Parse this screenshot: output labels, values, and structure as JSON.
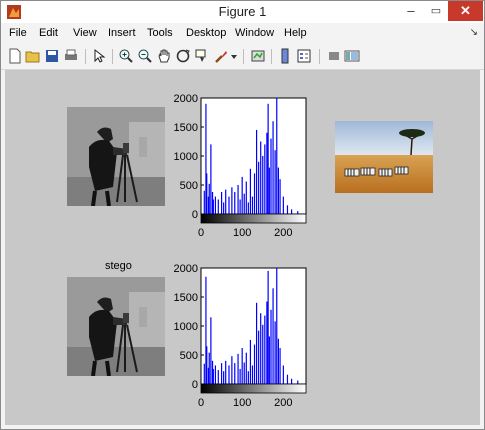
{
  "window": {
    "title": "Figure 1",
    "minimize_glyph": "–",
    "maximize_glyph": "▭",
    "close_glyph": "✕"
  },
  "menu": {
    "items": [
      "File",
      "Edit",
      "View",
      "Insert",
      "Tools",
      "Desktop",
      "Window",
      "Help"
    ],
    "dock_arrow": "↘"
  },
  "toolbar": {
    "icons": [
      "new-figure-icon",
      "open-file-icon",
      "save-figure-icon",
      "print-figure-icon",
      "edit-plot-icon",
      "zoom-in-icon",
      "zoom-out-icon",
      "pan-icon",
      "rotate-3d-icon",
      "data-cursor-icon",
      "brush-icon",
      "brush-dropdown-icon",
      "link-plot-icon",
      "insert-colorbar-icon",
      "insert-legend-icon",
      "hide-plot-tools-icon",
      "show-plot-tools-icon"
    ]
  },
  "colors": {
    "figure_bg": "#c8c8c8",
    "histogram_bar": "#0000ff",
    "close_button": "#c7392b"
  },
  "figure": {
    "stego_title": "stego"
  },
  "chart_data": [
    {
      "type": "bar",
      "xlim": [
        0,
        255
      ],
      "ylim": [
        0,
        2000
      ],
      "yticks": [
        0,
        500,
        1000,
        1500,
        2000
      ],
      "xticks": [
        0,
        100,
        200
      ],
      "colorbar": "grayscale",
      "bins": [
        [
          8,
          400
        ],
        [
          12,
          1900
        ],
        [
          14,
          700
        ],
        [
          18,
          300
        ],
        [
          20,
          520
        ],
        [
          24,
          1200
        ],
        [
          28,
          380
        ],
        [
          30,
          250
        ],
        [
          35,
          300
        ],
        [
          42,
          250
        ],
        [
          50,
          380
        ],
        [
          55,
          200
        ],
        [
          60,
          420
        ],
        [
          68,
          300
        ],
        [
          75,
          460
        ],
        [
          82,
          380
        ],
        [
          90,
          500
        ],
        [
          95,
          250
        ],
        [
          100,
          640
        ],
        [
          105,
          350
        ],
        [
          110,
          560
        ],
        [
          115,
          200
        ],
        [
          120,
          780
        ],
        [
          125,
          300
        ],
        [
          130,
          700
        ],
        [
          135,
          1450
        ],
        [
          140,
          900
        ],
        [
          145,
          1250
        ],
        [
          150,
          1000
        ],
        [
          155,
          1200
        ],
        [
          160,
          1400
        ],
        [
          163,
          1900
        ],
        [
          166,
          800
        ],
        [
          170,
          1300
        ],
        [
          175,
          1600
        ],
        [
          180,
          1100
        ],
        [
          184,
          2000
        ],
        [
          188,
          800
        ],
        [
          192,
          600
        ],
        [
          200,
          300
        ],
        [
          210,
          150
        ],
        [
          220,
          80
        ],
        [
          235,
          50
        ]
      ]
    },
    {
      "type": "bar",
      "xlim": [
        0,
        255
      ],
      "ylim": [
        0,
        2000
      ],
      "yticks": [
        0,
        500,
        1000,
        1500,
        2000
      ],
      "xticks": [
        0,
        100,
        200
      ],
      "colorbar": "grayscale",
      "bins": [
        [
          8,
          350
        ],
        [
          12,
          1850
        ],
        [
          14,
          650
        ],
        [
          18,
          280
        ],
        [
          20,
          540
        ],
        [
          24,
          1150
        ],
        [
          28,
          400
        ],
        [
          30,
          260
        ],
        [
          35,
          320
        ],
        [
          42,
          240
        ],
        [
          50,
          360
        ],
        [
          55,
          220
        ],
        [
          60,
          400
        ],
        [
          68,
          320
        ],
        [
          75,
          480
        ],
        [
          82,
          360
        ],
        [
          90,
          520
        ],
        [
          95,
          260
        ],
        [
          100,
          620
        ],
        [
          105,
          370
        ],
        [
          110,
          540
        ],
        [
          115,
          220
        ],
        [
          120,
          760
        ],
        [
          125,
          320
        ],
        [
          130,
          680
        ],
        [
          135,
          1400
        ],
        [
          140,
          920
        ],
        [
          145,
          1220
        ],
        [
          150,
          1020
        ],
        [
          155,
          1180
        ],
        [
          160,
          1420
        ],
        [
          163,
          1950
        ],
        [
          166,
          820
        ],
        [
          170,
          1280
        ],
        [
          175,
          1650
        ],
        [
          180,
          1080
        ],
        [
          184,
          2050
        ],
        [
          188,
          780
        ],
        [
          192,
          620
        ],
        [
          200,
          320
        ],
        [
          210,
          160
        ],
        [
          220,
          90
        ],
        [
          235,
          60
        ]
      ]
    }
  ]
}
